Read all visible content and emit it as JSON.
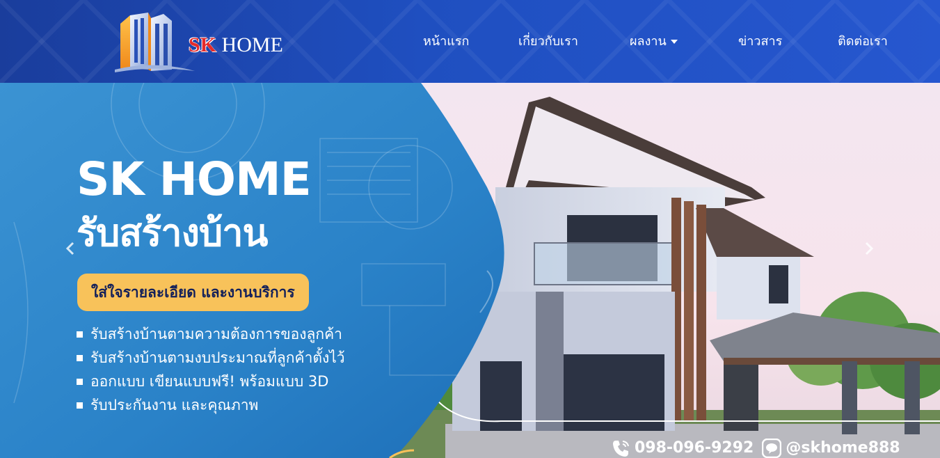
{
  "brand": {
    "sk": "SK",
    "home": "HOME"
  },
  "nav": {
    "items": [
      {
        "label": "หน้าแรก"
      },
      {
        "label": "เกี่ยวกับเรา"
      },
      {
        "label": "ผลงาน"
      },
      {
        "label": "ข่าวสาร"
      },
      {
        "label": "ติดต่อเรา"
      }
    ]
  },
  "hero": {
    "title": "SK HOME",
    "subtitle": "รับสร้างบ้าน",
    "tagline": "ใส่ใจรายละเอียด และงานบริการ",
    "bullets": [
      "รับสร้างบ้านตามความต้องการของลูกค้า",
      "รับสร้างบ้านตามงบประมาณที่ลูกค้าตั้งไว้",
      "ออกแบบ เขียนแบบฟรี! พร้อมแบบ 3D",
      "รับประกันงาน และคุณภาพ"
    ],
    "phone": "098-096-9292",
    "line_id": "@skhome888"
  },
  "icons": {
    "prev": "chevron-left-icon",
    "next": "chevron-right-icon",
    "phone": "phone-icon",
    "line": "line-app-icon",
    "dropdown": "caret-down-icon"
  },
  "colors": {
    "header": "#1f4fc0",
    "panel": "#2e86c9",
    "tagline_bg": "#f8c25a",
    "brand_red": "#e42b2b"
  }
}
